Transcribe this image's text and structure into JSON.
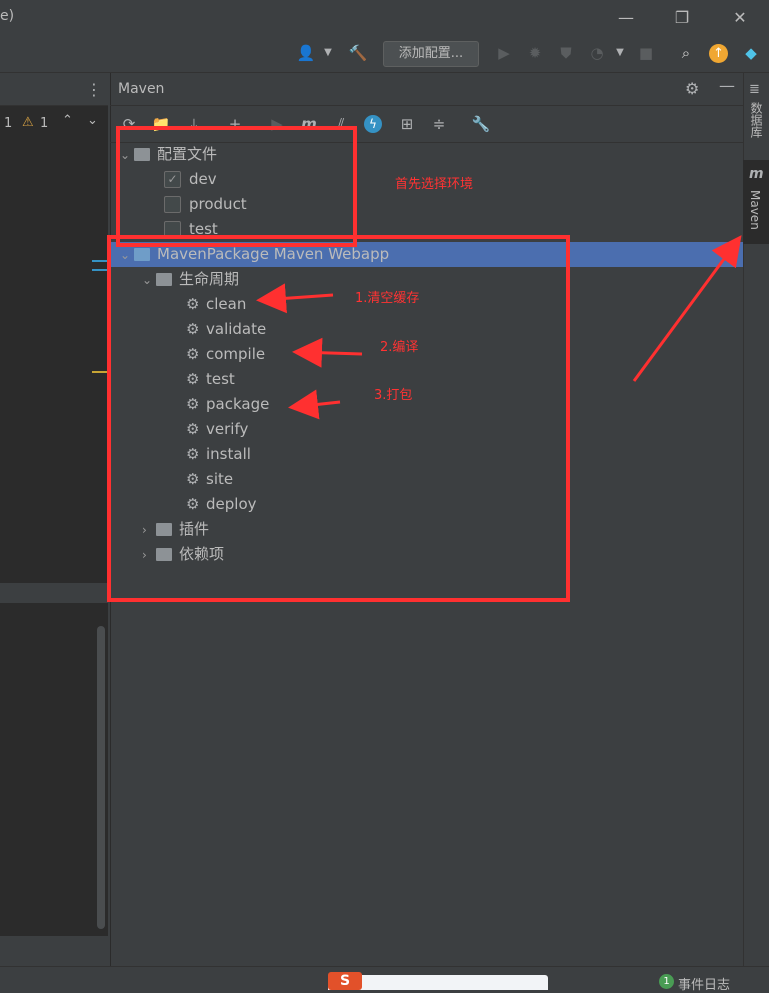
{
  "window": {
    "title_fragment": "e)",
    "controls": {
      "minimize": "—",
      "restore": "❐",
      "close": "✕"
    }
  },
  "toolbar": {
    "add_config_label": "添加配置..."
  },
  "editor": {
    "inspection_count_1": "1",
    "warning_count": "1"
  },
  "maven": {
    "title": "Maven",
    "profiles": {
      "label": "配置文件",
      "items": [
        {
          "label": "dev",
          "checked": true
        },
        {
          "label": "product",
          "checked": false
        },
        {
          "label": "test",
          "checked": false
        }
      ]
    },
    "project": {
      "label": "MavenPackage Maven Webapp",
      "lifecycle": {
        "label": "生命周期",
        "phases": [
          "clean",
          "validate",
          "compile",
          "test",
          "package",
          "verify",
          "install",
          "site",
          "deploy"
        ]
      },
      "plugins_label": "插件",
      "dependencies_label": "依赖项"
    }
  },
  "right_sidebar": {
    "database_tab": "数据库",
    "maven_tab": "Maven",
    "maven_tab_icon": "m"
  },
  "annotations": {
    "choose_env": "首先选择环境",
    "step1": "1.清空缓存",
    "step2": "2.编译",
    "step3": "3.打包",
    "color": "#ff3030"
  },
  "statusbar": {
    "event_count": "1",
    "event_log": "事件日志"
  },
  "colors": {
    "selection": "#4b6eaf",
    "background": "#3c3f41",
    "editor": "#2b2b2b"
  }
}
